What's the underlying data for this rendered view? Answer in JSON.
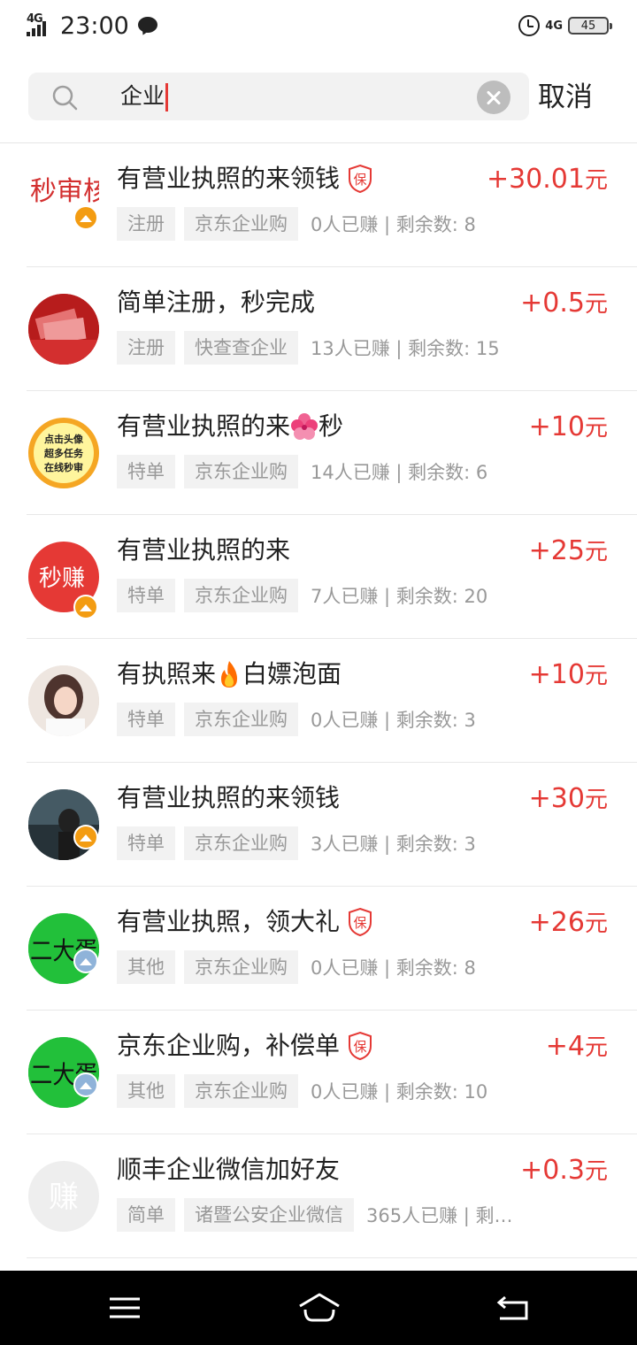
{
  "status_bar": {
    "network_left": "4G",
    "time": "23:00",
    "network_right": "4G",
    "battery": "45"
  },
  "search": {
    "value": "企业",
    "cancel_label": "取消"
  },
  "colors": {
    "accent_red": "#e53935",
    "tag_bg": "#f2f2f2",
    "muted_text": "#999999"
  },
  "items": [
    {
      "title": "有营业执照的来领钱",
      "guaranteed": true,
      "price": "+30.01",
      "unit": "元",
      "tags": [
        "注册",
        "京东企业购"
      ],
      "stats": "0人已赚 | 剩余数: 8",
      "avatar_text": "秒审核",
      "crown": "gold"
    },
    {
      "title": "简单注册，秒完成",
      "guaranteed": false,
      "price": "+0.5",
      "unit": "元",
      "tags": [
        "注册",
        "快查查企业"
      ],
      "stats": "13人已赚 | 剩余数: 15",
      "avatar_text": "",
      "crown": ""
    },
    {
      "title_a": "有营业执照的来",
      "title_b": "秒",
      "emoji": "hibiscus-emoji",
      "guaranteed": false,
      "price": "+10",
      "unit": "元",
      "tags": [
        "特单",
        "京东企业购"
      ],
      "stats": "14人已赚 | 剩余数: 6",
      "avatar_lines": [
        "点击头像",
        "超多任务",
        "在线秒审"
      ],
      "crown": ""
    },
    {
      "title": "有营业执照的来",
      "guaranteed": false,
      "price": "+25",
      "unit": "元",
      "tags": [
        "特单",
        "京东企业购"
      ],
      "stats": "7人已赚 | 剩余数: 20",
      "avatar_text": "秒赚",
      "crown": "gold"
    },
    {
      "title_a": "有执照来",
      "title_b": "白嫖泡面",
      "emoji": "fire-emoji",
      "guaranteed": false,
      "price": "+10",
      "unit": "元",
      "tags": [
        "特单",
        "京东企业购"
      ],
      "stats": "0人已赚 | 剩余数: 3",
      "crown": ""
    },
    {
      "title": "有营业执照的来领钱",
      "guaranteed": false,
      "price": "+30",
      "unit": "元",
      "tags": [
        "特单",
        "京东企业购"
      ],
      "stats": "3人已赚 | 剩余数: 3",
      "crown": "gold"
    },
    {
      "title": "有营业执照，领大礼",
      "guaranteed": true,
      "price": "+26",
      "unit": "元",
      "tags": [
        "其他",
        "京东企业购"
      ],
      "stats": "0人已赚 | 剩余数: 8",
      "avatar_text": "二大蛋",
      "crown": "silver"
    },
    {
      "title": "京东企业购，补偿单",
      "guaranteed": true,
      "price": "+4",
      "unit": "元",
      "tags": [
        "其他",
        "京东企业购"
      ],
      "stats": "0人已赚 | 剩余数: 10",
      "avatar_text": "二大蛋",
      "crown": "silver"
    },
    {
      "title": "顺丰企业微信加好友",
      "guaranteed": false,
      "price": "+0.3",
      "unit": "元",
      "tags": [
        "简单",
        "诸暨公安企业微信"
      ],
      "stats": "365人已赚 | 剩…",
      "avatar_text": "赚",
      "crown": ""
    }
  ]
}
